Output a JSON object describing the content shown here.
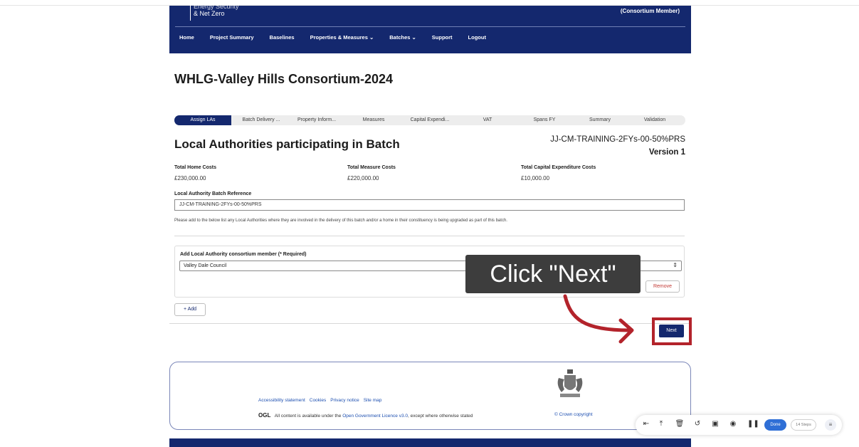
{
  "header": {
    "logo_line1": "Energy Security",
    "logo_line2": "& Net Zero",
    "member_label": "(Consortium Member)",
    "nav": [
      "Home",
      "Project Summary",
      "Baselines",
      "Properties & Measures ⌄",
      "Batches ⌄",
      "Support",
      "Logout"
    ]
  },
  "page_title": "WHLG-Valley Hills Consortium-2024",
  "path_steps": [
    "Assign LAs",
    "Batch Delivery ...",
    "Property Inform...",
    "Measures",
    "Capital Expendi...",
    "VAT",
    "Spans FY",
    "Summary",
    "Validation"
  ],
  "section": {
    "title": "Local Authorities participating in Batch",
    "batch_ref": "JJ-CM-TRAINING-2FYs-00-50%PRS",
    "version": "Version 1"
  },
  "costs": [
    {
      "label": "Total Home Costs",
      "value": "£230,000.00"
    },
    {
      "label": "Total Measure Costs",
      "value": "£220,000.00"
    },
    {
      "label": "Total Capital Expenditure Costs",
      "value": "£10,000.00"
    }
  ],
  "reference": {
    "label": "Local Authority Batch Reference",
    "value": "JJ-CM-TRAINING-2FYs-00-50%PRS"
  },
  "help_text": "Please add to the below list any Local Authorities where they are involved in the delivery of this batch and/or a home in their constituency is being upgraded as part of this batch.",
  "card": {
    "label": "Add Local Authority consortium member (* Required)",
    "selected": "Valley Dale Council",
    "remove_label": "Remove"
  },
  "add_label": "+ Add",
  "next_label": "Next",
  "callout": "Click \"Next\"",
  "footer": {
    "links": [
      "Accessibility statement",
      "Cookies",
      "Privacy notice",
      "Site map"
    ],
    "ogl": "OGL",
    "licence_prefix": "All content is available under the",
    "licence_link": "Open Government Licence v3.0",
    "licence_suffix": ", except where otherwise stated",
    "crown": "© Crown copyright"
  },
  "toolbar": {
    "done_label": "Done",
    "steps_label": "14 Steps"
  },
  "colors": {
    "brand": "#14286e",
    "highlight": "#b3232b",
    "callout_bg": "#3d3d3d"
  }
}
